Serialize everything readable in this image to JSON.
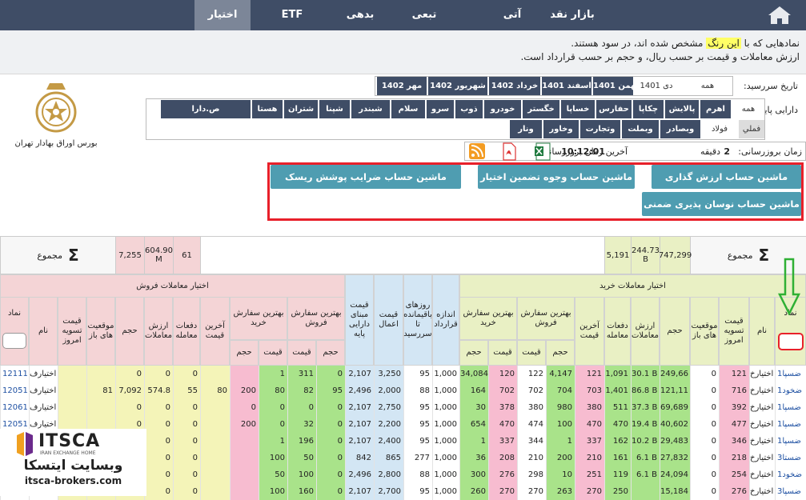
{
  "nav": {
    "tabs": [
      "بازار نقد",
      "آتی",
      "تبعی",
      "بدهی",
      "ETF",
      "اختیار"
    ],
    "active": "اختیار"
  },
  "notice": {
    "line1_pre": "نمادهایی که با",
    "line1_hl": "این رنگ",
    "line1_post": "مشخص شده اند، در سود هستند.",
    "line2": "ارزش معاملات و قیمت بر حسب ریال، و حجم بر حسب قرارداد است."
  },
  "logo": {
    "caption": "بورس اوراق بهادار تهران"
  },
  "maturity": {
    "label": "تاریخ سررسید:",
    "all": "همه",
    "options": [
      "1401 دی",
      "1401 بهمن",
      "1401 اسفند",
      "1402 خرداد",
      "1402 شهریور",
      "1402 مهر"
    ]
  },
  "base": {
    "label": "دارایی پایه:",
    "all": "همه",
    "row1": [
      "اهرم",
      "پالایش",
      "چکاپا",
      "حفارس",
      "خساپا",
      "خگستر",
      "خودرو",
      "ذوب",
      "سرو",
      "سلام",
      "شبندر",
      "شپنا",
      "شتران",
      "هستا",
      "ص.دارا"
    ],
    "row2": [
      "فملي",
      "فولاد",
      "وبصادر",
      "وبملت",
      "وتجارت",
      "وخاور",
      "ونار"
    ]
  },
  "update": {
    "label": "زمان بروزرسانی:",
    "value": "2",
    "unit": "دقیقه",
    "last_label": "آخرین زمان بروزرسانی:",
    "last_value": "10:12:01"
  },
  "calc_buttons": [
    "ماشین حساب ارزش گذاری اختیار",
    "ماشین حساب وجوه تضمین اختیار",
    "ماشین حساب ضرایب پوشش ریسک اختیار",
    "ماشین حساب نوسان پذیری ضمنی اختیار"
  ],
  "summary": {
    "label": "مجموع",
    "sigma": "Σ",
    "buy": [
      "747,299",
      "244.73\nB",
      "5,191"
    ],
    "sell": [
      "61",
      "604.90\nM",
      "7,255"
    ]
  },
  "headers": {
    "buy_group": "اختیار معاملات خرید",
    "sell_group": "اختیار معاملات فروش",
    "symbol": "نماد",
    "name": "نام",
    "settle": "قیمت تسویه امروز",
    "open_pos": "موقعیت های باز",
    "volume": "حجم",
    "value": "ارزش معاملات",
    "trades": "دفعات معامله",
    "last": "آخرین قیمت",
    "best_sell": "بهترین سفارش فروش",
    "best_buy": "بهترین سفارش خرید",
    "qty": "حجم",
    "price": "قیمت",
    "contract": "اندازه قرارداد",
    "days": "روزهای باقیمانده تا سررسید",
    "strike": "قیمت اعمال",
    "base_price": "قیمت مبنای دارایی پایه"
  },
  "rows": [
    {
      "bsym": "ضسپا1",
      "bname": "اختیارخ",
      "bset": "121",
      "bpos": "0",
      "bvol": "249,66",
      "bval": "30.1 B",
      "btr": "1,091",
      "blast": "121",
      "bsq": "4,147",
      "bsp": "122",
      "bbp": "120",
      "bbq": "34,084",
      "size": "1,000",
      "days": "95",
      "strike": "3,250",
      "basep": "2,107",
      "ssq": "0",
      "ssp": "311",
      "sbp": "1",
      "sbq": "",
      "slast": "",
      "str": "0",
      "sval": "0",
      "svol": "0",
      "spos": "",
      "sset": "",
      "sname": "اختیارف",
      "ssym": "12111"
    },
    {
      "bsym": "ضخود1",
      "bname": "اختیارخ",
      "bset": "716",
      "bpos": "0",
      "bvol": "121,11",
      "bval": "86.8 B",
      "btr": "1,401",
      "blast": "703",
      "bsq": "704",
      "bsp": "702",
      "bbp": "702",
      "bbq": "164",
      "size": "1,000",
      "days": "88",
      "strike": "2,000",
      "basep": "2,496",
      "ssq": "95",
      "ssp": "82",
      "sbp": "80",
      "sbq": "200",
      "slast": "80",
      "str": "55",
      "sval": "574.8",
      "svol": "7,092",
      "spos": "81",
      "sset": "",
      "sname": "اختیارف",
      "ssym": "12051"
    },
    {
      "bsym": "ضسپا1",
      "bname": "اختیارخ",
      "bset": "392",
      "bpos": "0",
      "bvol": "69,689",
      "bval": "37.3 B",
      "btr": "511",
      "blast": "380",
      "bsq": "980",
      "bsp": "380",
      "bbp": "378",
      "bbq": "30",
      "size": "1,000",
      "days": "95",
      "strike": "2,750",
      "basep": "2,107",
      "ssq": "0",
      "ssp": "0",
      "sbp": "0",
      "sbq": "0",
      "slast": "",
      "str": "0",
      "sval": "0",
      "svol": "0",
      "spos": "",
      "sset": "",
      "sname": "اختیارف",
      "ssym": "12061"
    },
    {
      "bsym": "ضسپا1",
      "bname": "اختیارخ",
      "bset": "477",
      "bpos": "0",
      "bvol": "40,602",
      "bval": "19.4 B",
      "btr": "470",
      "blast": "470",
      "bsq": "100",
      "bsp": "474",
      "bbp": "470",
      "bbq": "654",
      "size": "1,000",
      "days": "95",
      "strike": "2,200",
      "basep": "2,107",
      "ssq": "0",
      "ssp": "32",
      "sbp": "0",
      "sbq": "200",
      "slast": "",
      "str": "0",
      "sval": "0",
      "svol": "0",
      "spos": "",
      "sset": "",
      "sname": "اختیارف",
      "ssym": "12051"
    },
    {
      "bsym": "ضسپا1",
      "bname": "اختیارخ",
      "bset": "346",
      "bpos": "0",
      "bvol": "29,483",
      "bval": "10.2 B",
      "btr": "162",
      "blast": "337",
      "bsq": "1",
      "bsp": "344",
      "bbp": "337",
      "bbq": "1",
      "size": "1,000",
      "days": "95",
      "strike": "2,400",
      "basep": "2,107",
      "ssq": "0",
      "ssp": "196",
      "sbp": "1",
      "sbq": "",
      "slast": "",
      "str": "0",
      "sval": "0",
      "svol": "0",
      "spos": "",
      "sset": "",
      "sname": "",
      "ssym": ""
    },
    {
      "bsym": "ضستا3",
      "bname": "اختیارخ",
      "bset": "218",
      "bpos": "0",
      "bvol": "27,832",
      "bval": "6.1 B",
      "btr": "161",
      "blast": "210",
      "bsq": "200",
      "bsp": "210",
      "bbp": "208",
      "bbq": "36",
      "size": "1,000",
      "days": "277",
      "strike": "865",
      "basep": "842",
      "ssq": "0",
      "ssp": "50",
      "sbp": "100",
      "sbq": "",
      "slast": "",
      "str": "0",
      "sval": "0",
      "svol": "0",
      "spos": "",
      "sset": "",
      "sname": "",
      "ssym": ""
    },
    {
      "bsym": "ضخود1",
      "bname": "اختیارخ",
      "bset": "254",
      "bpos": "0",
      "bvol": "24,094",
      "bval": "6.1 B",
      "btr": "119",
      "blast": "251",
      "bsq": "10",
      "bsp": "298",
      "bbp": "276",
      "bbq": "300",
      "size": "1,000",
      "days": "88",
      "strike": "2,800",
      "basep": "2,496",
      "ssq": "0",
      "ssp": "100",
      "sbp": "50",
      "sbq": "",
      "slast": "",
      "str": "0",
      "sval": "0",
      "svol": "0",
      "spos": "",
      "sset": "",
      "sname": "",
      "ssym": ""
    },
    {
      "bsym": "ضسپا3",
      "bname": "اختیارخ",
      "bset": "276",
      "bpos": "0",
      "bvol": "15,184",
      "bval": "",
      "btr": "250",
      "blast": "270",
      "bsq": "263",
      "bsp": "270",
      "bbp": "270",
      "bbq": "260",
      "size": "1,000",
      "days": "95",
      "strike": "2,700",
      "basep": "2,107",
      "ssq": "0",
      "ssp": "160",
      "sbp": "100",
      "sbq": "",
      "slast": "",
      "str": "0",
      "sval": "0",
      "svol": "0",
      "spos": "",
      "sset": "",
      "sname": "",
      "ssym": ""
    }
  ],
  "watermark": {
    "brand": "ITSCA",
    "sub": "IRAN EXCHANGE HOME",
    "fa": "وبسایت ایتسکا",
    "url": "itsca-brokers.com"
  }
}
